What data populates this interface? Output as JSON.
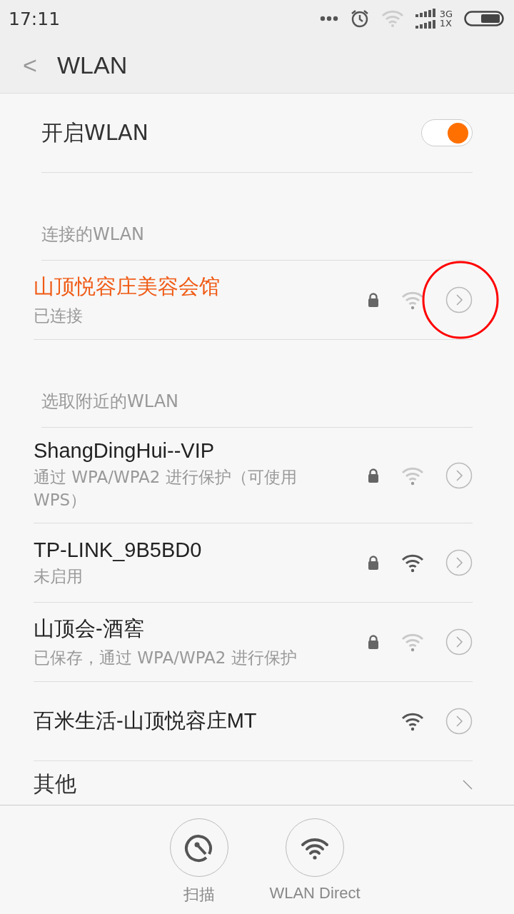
{
  "status_bar": {
    "time": "17:11",
    "network_top": "3G",
    "network_bottom": "1X"
  },
  "header": {
    "back": "<",
    "title": "WLAN"
  },
  "wlan_toggle": {
    "label": "开启WLAN",
    "on": true
  },
  "connected_section": {
    "title": "连接的WLAN",
    "networks": [
      {
        "name": "山顶悦容庄美容会馆",
        "status": "已连接",
        "secured": true,
        "strong": false,
        "connected": true,
        "highlighted": true
      }
    ]
  },
  "nearby_section": {
    "title": "选取附近的WLAN",
    "networks": [
      {
        "name": "ShangDingHui--VIP",
        "status": "通过 WPA/WPA2 进行保护（可使用 WPS）",
        "secured": true,
        "strong": false,
        "connected": false,
        "highlighted": false
      },
      {
        "name": "TP-LINK_9B5BD0",
        "status": "未启用",
        "secured": true,
        "strong": true,
        "connected": false,
        "highlighted": false
      },
      {
        "name": "山顶会-酒窖",
        "status": "已保存，通过 WPA/WPA2 进行保护",
        "secured": true,
        "strong": false,
        "connected": false,
        "highlighted": false
      },
      {
        "name": "百米生活-山顶悦容庄MT",
        "secured": false,
        "strong": true,
        "connected": false,
        "highlighted": false
      }
    ]
  },
  "other": {
    "label": "其他"
  },
  "bottom_bar": [
    {
      "kind": "scan",
      "label": "扫描"
    },
    {
      "kind": "direct",
      "label": "WLAN Direct"
    }
  ]
}
